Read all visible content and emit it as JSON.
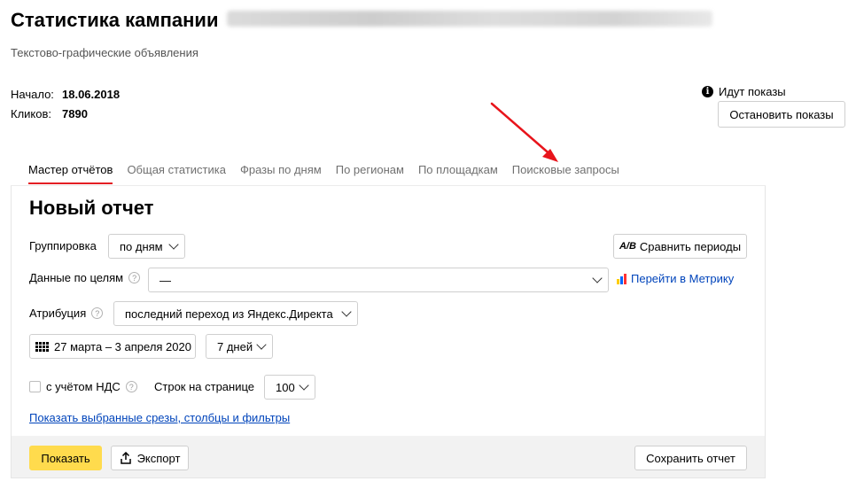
{
  "header": {
    "title": "Статистика кампании",
    "subtitle": "Текстово-графические объявления"
  },
  "info": {
    "start_label": "Начало:",
    "start_value": "18.06.2018",
    "clicks_label": "Кликов:",
    "clicks_value": "7890"
  },
  "status": {
    "text": "Идут показы",
    "icon": "info-icon",
    "stop_button": "Остановить показы"
  },
  "tabs": [
    {
      "label": "Мастер отчётов",
      "active": true
    },
    {
      "label": "Общая статистика",
      "active": false
    },
    {
      "label": "Фразы по дням",
      "active": false
    },
    {
      "label": "По регионам",
      "active": false
    },
    {
      "label": "По площадкам",
      "active": false
    },
    {
      "label": "Поисковые запросы",
      "active": false
    }
  ],
  "report": {
    "title": "Новый отчет",
    "grouping_label": "Группировка",
    "grouping_value": "по дням",
    "compare_button": "Сравнить периоды",
    "goals_label": "Данные по целям",
    "goals_value": "—",
    "metrika_link": "Перейти в Метрику",
    "attribution_label": "Атрибуция",
    "attribution_value": "последний переход из Яндекс.Директа",
    "date_range": "27 марта – 3 апреля 2020",
    "period_value": "7 дней",
    "vat_label": "с учётом НДС",
    "rows_label": "Строк на странице",
    "rows_value": "100",
    "show_filters_link": "Показать выбранные срезы, столбцы и фильтры"
  },
  "footer": {
    "show_button": "Показать",
    "export_button": "Экспорт",
    "save_button": "Сохранить отчет"
  },
  "colors": {
    "accent_red": "#e31e24",
    "yellow_button": "#ffdb4d",
    "link_blue": "#0044bb",
    "arrow_red": "#e8141b"
  }
}
